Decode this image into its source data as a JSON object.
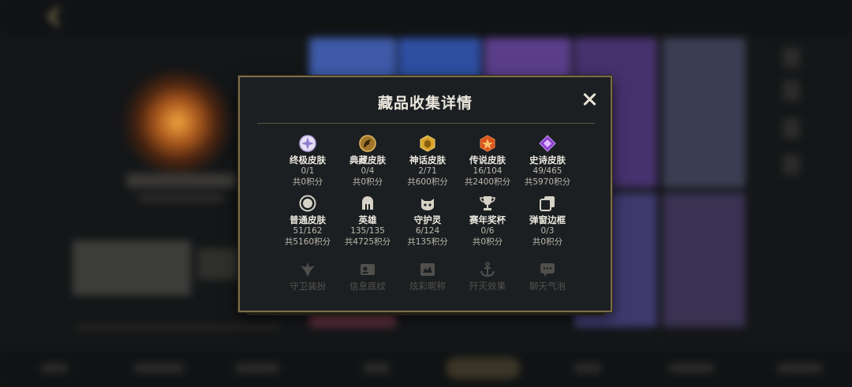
{
  "modal": {
    "title": "藏品收集详情",
    "items": [
      {
        "label": "终极皮肤",
        "count": "0/1",
        "points": "共0积分",
        "icon": "ultimate-skin-icon"
      },
      {
        "label": "典藏皮肤",
        "count": "0/4",
        "points": "共0积分",
        "icon": "exalted-skin-icon"
      },
      {
        "label": "神话皮肤",
        "count": "2/71",
        "points": "共600积分",
        "icon": "mythic-skin-icon"
      },
      {
        "label": "传说皮肤",
        "count": "16/104",
        "points": "共2400积分",
        "icon": "legendary-skin-icon"
      },
      {
        "label": "史诗皮肤",
        "count": "49/465",
        "points": "共5970积分",
        "icon": "epic-skin-icon"
      },
      {
        "label": "普通皮肤",
        "count": "51/162",
        "points": "共5160积分",
        "icon": "normal-skin-icon"
      },
      {
        "label": "英雄",
        "count": "135/135",
        "points": "共4725积分",
        "icon": "champion-helmet-icon"
      },
      {
        "label": "守护灵",
        "count": "6/124",
        "points": "共135积分",
        "icon": "guardian-spirit-icon"
      },
      {
        "label": "赛年奖杯",
        "count": "0/6",
        "points": "共0积分",
        "icon": "trophy-icon"
      },
      {
        "label": "弹窗边框",
        "count": "0/3",
        "points": "共0积分",
        "icon": "frame-icon"
      },
      {
        "label": "守卫装扮",
        "icon": "ward-skin-icon"
      },
      {
        "label": "信息底纹",
        "icon": "info-card-icon"
      },
      {
        "label": "炫彩昵称",
        "icon": "nickname-icon"
      },
      {
        "label": "歼灭效果",
        "icon": "anchor-icon"
      },
      {
        "label": "聊天气泡",
        "icon": "chat-bubble-icon"
      }
    ]
  },
  "colors": {
    "accent_gold": "#7d6d48",
    "panel_bg": "#1c1f22",
    "text_primary": "#ece9df",
    "text_secondary": "#bdb9ad"
  }
}
